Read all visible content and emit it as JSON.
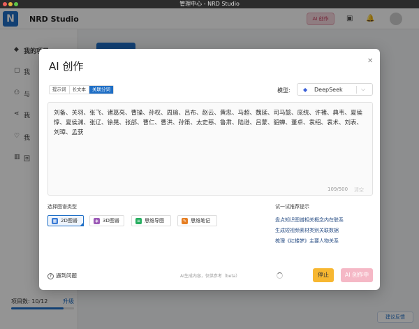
{
  "window": {
    "title": "管理中心 - NRD Studio"
  },
  "header": {
    "logo": "N",
    "app_name": "NRD Studio",
    "ai_button": "AI 创作"
  },
  "sidebar": {
    "items": [
      {
        "label": "我的项目"
      },
      {
        "label": "我"
      },
      {
        "label": "与"
      },
      {
        "label": "我"
      },
      {
        "label": "我"
      },
      {
        "label": "回"
      }
    ],
    "project_count": "项目数: 10/12",
    "upgrade": "升级",
    "progress_fraction": 0.83
  },
  "feedback": "建议反馈",
  "modal": {
    "title": "AI 创作",
    "tabs": [
      "提示词",
      "长文本",
      "关联分词"
    ],
    "active_tab": 2,
    "model_label": "模型:",
    "model_value": "DeepSeek",
    "text": "刘备、关羽、张飞、诸葛亮、曹操、孙权、周瑜、吕布、赵云、黄忠、马超、魏延、司马懿、庞统、许褚、典韦、夏侯惇、夏侯渊、张辽、徐晃、张郃、曹仁、曹洪、孙策、太史慈、鲁肃、陆逊、吕蒙、貂蝉、董卓、袁绍、袁术、刘表、刘璋、孟获",
    "counter": "109/500",
    "clear": "清空",
    "graph_type_label": "选择图谱类型",
    "graph_types": [
      {
        "label": "2D图谱",
        "icon": "2d-icon",
        "color": "#3a7bd5"
      },
      {
        "label": "3D图谱",
        "icon": "3d-icon",
        "color": "#9b59b6"
      },
      {
        "label": "思维导图",
        "icon": "mindmap-icon",
        "color": "#27ae60"
      },
      {
        "label": "思维笔记",
        "icon": "note-icon",
        "color": "#e67e22"
      }
    ],
    "tips_title": "试一试推荐提示",
    "tips": [
      "盘点知识图谱相关概念内在联系",
      "生成短视频素材类别关联数据",
      "梳理《红楼梦》主要人物关系"
    ],
    "help": "遇到问题",
    "disclaimer": "AI生成内容，仅供参考（beta）",
    "stop": "停止",
    "creating": "AI 创作中"
  }
}
